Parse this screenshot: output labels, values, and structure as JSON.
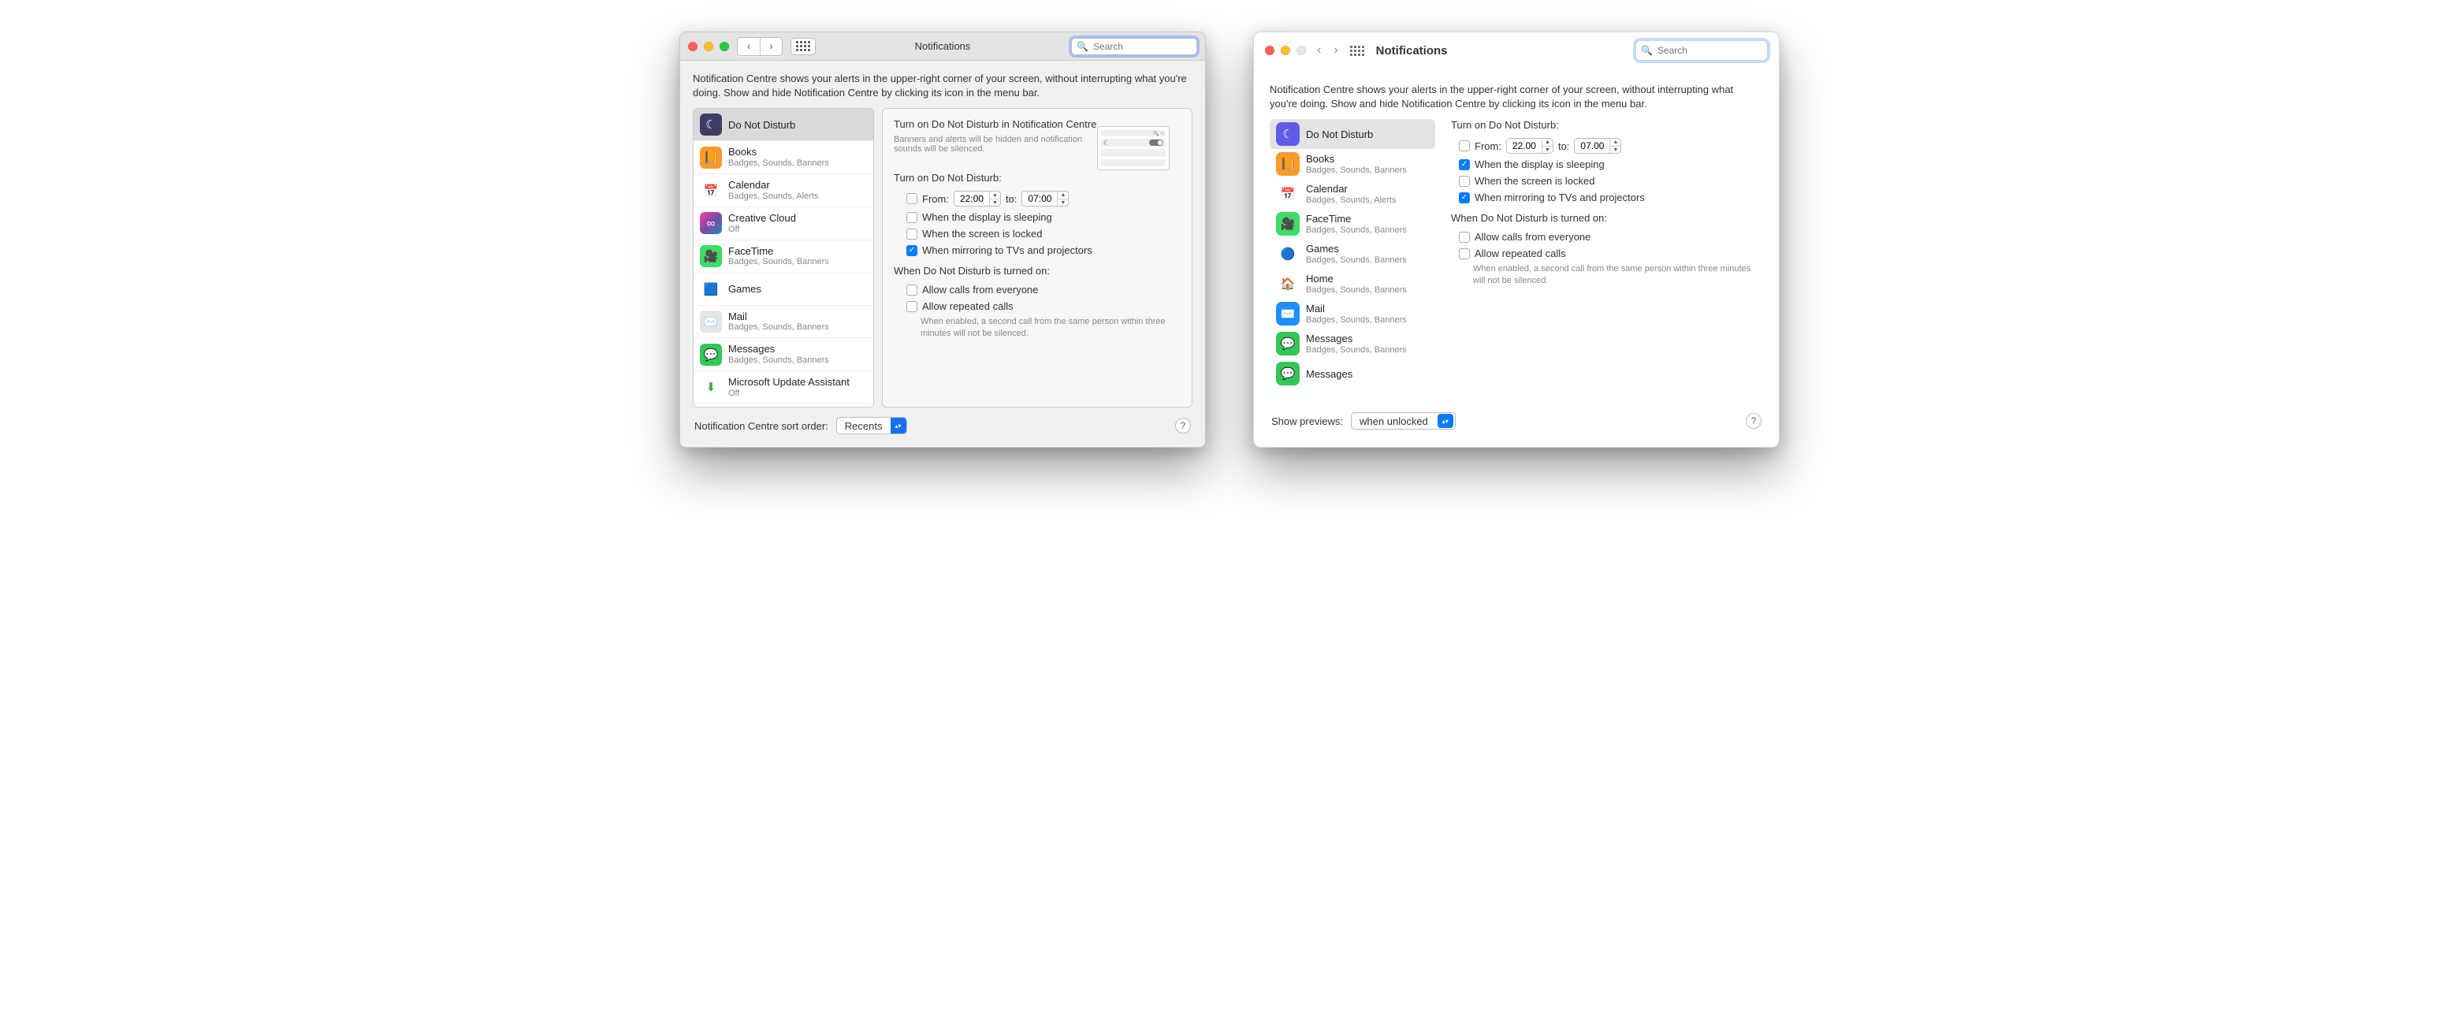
{
  "header": {
    "title": "Notifications",
    "search_placeholder": "Search"
  },
  "intro": "Notification Centre shows your alerts in the upper-right corner of your screen, without interrupting what you're doing. Show and hide Notification Centre by clicking its icon in the menu bar.",
  "left": {
    "sidebar": [
      {
        "label": "Do Not Disturb",
        "sub": "",
        "selected": true,
        "bg": "#3d3d66",
        "glyph": "☾"
      },
      {
        "label": "Books",
        "sub": "Badges, Sounds, Banners",
        "bg": "#ff9a2a",
        "glyph": "📙"
      },
      {
        "label": "Calendar",
        "sub": "Badges, Sounds, Alerts",
        "bg": "#ffffff",
        "glyph": "📅",
        "fg": "#d33"
      },
      {
        "label": "Creative Cloud",
        "sub": "Off",
        "bg": "linear-gradient(135deg,#ff3cac,#784ba0,#2b86c5)",
        "glyph": "∞"
      },
      {
        "label": "FaceTime",
        "sub": "Badges, Sounds, Banners",
        "bg": "#3ddc64",
        "glyph": "🎥"
      },
      {
        "label": "Games",
        "sub": "",
        "bg": "#ffffff",
        "glyph": "🟦",
        "fg": "#2a7"
      },
      {
        "label": "Mail",
        "sub": "Badges, Sounds, Banners",
        "bg": "#e5e5e5",
        "glyph": "✉️",
        "fg": "#2a6"
      },
      {
        "label": "Messages",
        "sub": "Badges, Sounds, Banners",
        "bg": "#33c759",
        "glyph": "💬"
      },
      {
        "label": "Microsoft Update Assistant",
        "sub": "Off",
        "bg": "#fff",
        "glyph": "⬇",
        "fg": "#3a3"
      }
    ],
    "detail": {
      "heading": "Turn on Do Not Disturb in Notification Centre",
      "subtext": "Banners and alerts will be hidden and notification sounds will be silenced.",
      "sectionA": "Turn on Do Not Disturb:",
      "from_label": "From:",
      "from_value": "22:00",
      "to_label": "to:",
      "to_value": "07:00",
      "opt_sleep": "When the display is sleeping",
      "opt_lock": "When the screen is locked",
      "opt_mirror": "When mirroring to TVs and projectors",
      "sectionB": "When Do Not Disturb is turned on:",
      "opt_calls": "Allow calls from everyone",
      "opt_repeat": "Allow repeated calls",
      "note": "When enabled, a second call from the same person within three minutes will not be silenced.",
      "checks": {
        "from": false,
        "sleep": false,
        "lock": false,
        "mirror": true,
        "calls": false,
        "repeat": false
      }
    },
    "footer": {
      "label": "Notification Centre sort order:",
      "value": "Recents"
    }
  },
  "right": {
    "sidebar": [
      {
        "label": "Do Not Disturb",
        "sub": "",
        "selected": true,
        "bg": "#5e5ce6",
        "glyph": "☾"
      },
      {
        "label": "Books",
        "sub": "Badges, Sounds, Banners",
        "bg": "#ff9a2a",
        "glyph": "📙"
      },
      {
        "label": "Calendar",
        "sub": "Badges, Sounds, Alerts",
        "bg": "#ffffff",
        "glyph": "📅",
        "fg": "#d33"
      },
      {
        "label": "FaceTime",
        "sub": "Badges, Sounds, Banners",
        "bg": "#3ddc64",
        "glyph": "🎥"
      },
      {
        "label": "Games",
        "sub": "Badges, Sounds, Banners",
        "bg": "#ffffff",
        "glyph": "🔵",
        "fg": "#666"
      },
      {
        "label": "Home",
        "sub": "Badges, Sounds, Banners",
        "bg": "#ffffff",
        "glyph": "🏠",
        "fg": "#f7a"
      },
      {
        "label": "Mail",
        "sub": "Badges, Sounds, Banners",
        "bg": "#1f8fff",
        "glyph": "✉️"
      },
      {
        "label": "Messages",
        "sub": "Badges, Sounds, Banners",
        "bg": "#33c759",
        "glyph": "💬"
      },
      {
        "label": "Messages",
        "sub": "",
        "bg": "#33c759",
        "glyph": "💬"
      }
    ],
    "detail": {
      "sectionA": "Turn on Do Not Disturb:",
      "from_label": "From:",
      "from_value": "22.00",
      "to_label": "to:",
      "to_value": "07.00",
      "opt_sleep": "When the display is sleeping",
      "opt_lock": "When the screen is locked",
      "opt_mirror": "When mirroring to TVs and projectors",
      "sectionB": "When Do Not Disturb is turned on:",
      "opt_calls": "Allow calls from everyone",
      "opt_repeat": "Allow repeated calls",
      "note": "When enabled, a second call from the same person within three minutes will not be silenced.",
      "checks": {
        "from": false,
        "sleep": true,
        "lock": false,
        "mirror": true,
        "calls": false,
        "repeat": false
      }
    },
    "footer": {
      "label": "Show previews:",
      "value": "when unlocked"
    }
  }
}
